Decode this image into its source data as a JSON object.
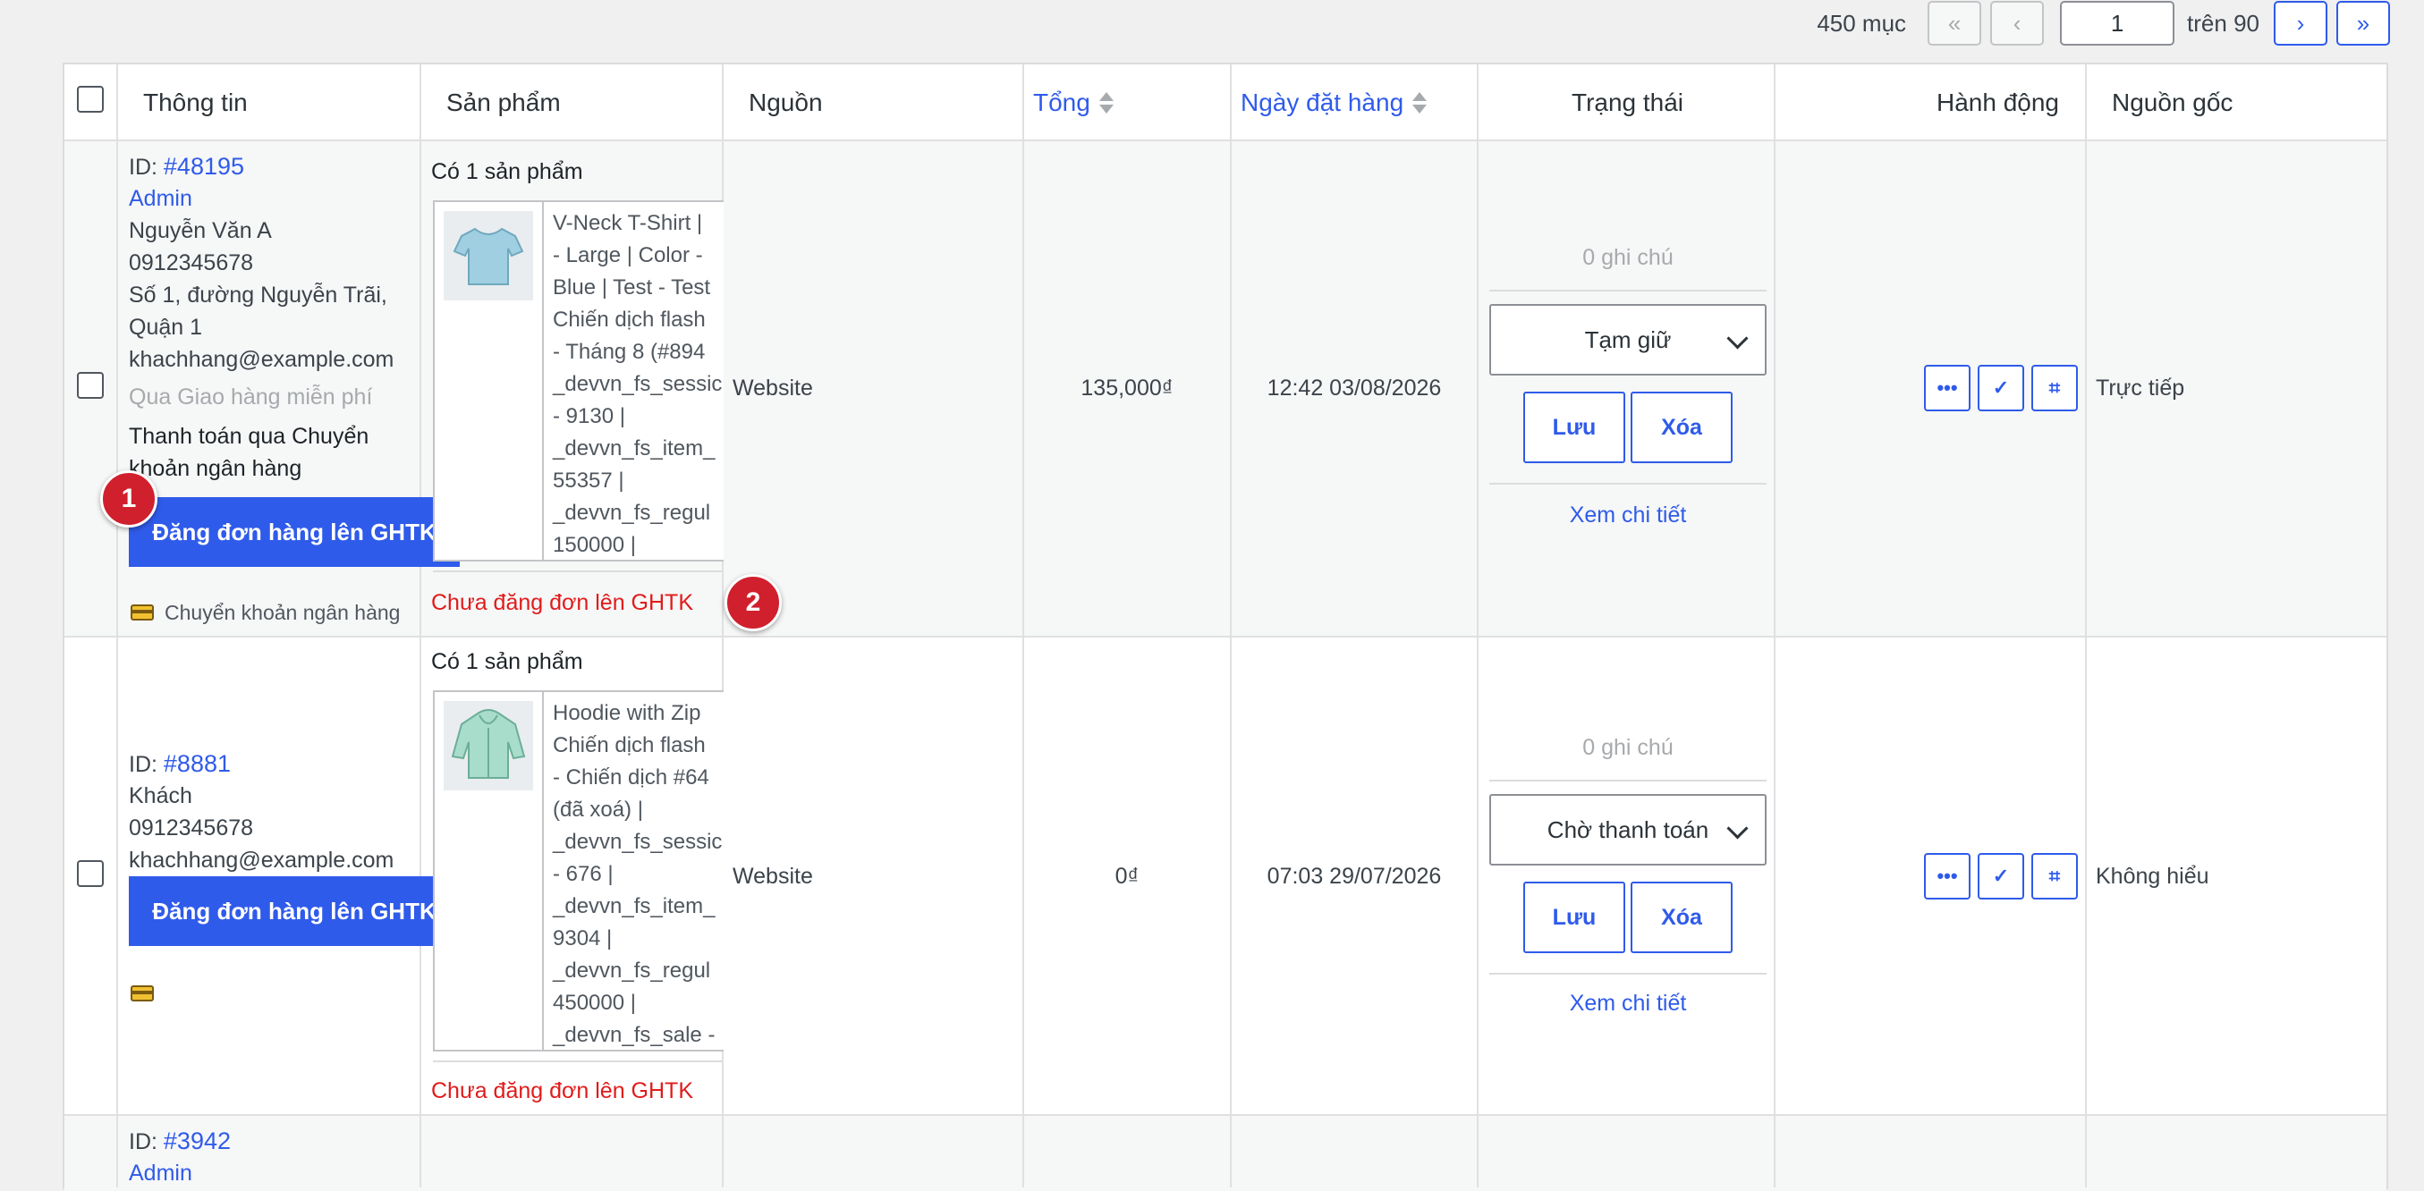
{
  "pagination": {
    "count_text": "450 mục",
    "first": "«",
    "prev": "‹",
    "current_page": "1",
    "total_text": "trên 90",
    "next": "›",
    "last": "»"
  },
  "columns": [
    "Thông tin",
    "Sản phẩm",
    "Nguồn",
    "Tổng",
    "Ngày đặt hàng",
    "Trạng thái",
    "Hành động",
    "Nguồn gốc"
  ],
  "orders": [
    {
      "id_prefix": "ID:",
      "id": "#48195",
      "creator": "Admin",
      "name": "Nguyễn Văn A",
      "phone": "0912345678",
      "address1": "Số 1, đường Nguyễn Trãi,",
      "address2": "Quận 1",
      "email": "khachhang@example.com",
      "shipping": "Qua Giao hàng miễn phí",
      "payment1": "Thanh toán qua Chuyển",
      "payment2": "khoản ngân hàng",
      "ghtk_button": "Đăng đơn hàng lên GHTK",
      "payment_badge": "Chuyển khoản ngân hàng",
      "product_count": "Có 1 sản phẩm",
      "product_lines": [
        "V-Neck T-Shirt |",
        "- Large | Color -",
        "Blue | Test - Test",
        "Chiến dịch flash",
        "- Tháng 8 (#894",
        "_devvn_fs_sessic",
        "- 9130 |",
        "_devvn_fs_item_",
        "55357 |",
        "_devvn_fs_regul",
        "150000 |"
      ],
      "ghtk_status": "Chưa đăng đơn lên GHTK",
      "source": "Website",
      "total": "135,000₫",
      "date": "12:42 03/08/2026",
      "notes": "0 ghi chú",
      "status": "Tạm giữ",
      "save": "Lưu",
      "delete": "Xóa",
      "view": "Xem chi tiết",
      "origin": "Trực tiếp"
    },
    {
      "id_prefix": "ID:",
      "id": "#8881",
      "creator": "Khách",
      "phone": "0912345678",
      "email": "khachhang@example.com",
      "ghtk_button": "Đăng đơn hàng lên GHTK",
      "product_count": "Có 1 sản phẩm",
      "product_lines": [
        "Hoodie with Zip",
        "Chiến dịch flash",
        "- Chiến dịch #64",
        "(đã xoá) |",
        "_devvn_fs_sessic",
        "- 676 |",
        "_devvn_fs_item_",
        "9304 |",
        "_devvn_fs_regul",
        "450000 |",
        "_devvn_fs_sale -"
      ],
      "ghtk_status": "Chưa đăng đơn lên GHTK",
      "source": "Website",
      "total": "0₫",
      "date": "07:03 29/07/2026",
      "notes": "0 ghi chú",
      "status": "Chờ thanh toán",
      "save": "Lưu",
      "delete": "Xóa",
      "view": "Xem chi tiết",
      "origin": "Không hiểu"
    },
    {
      "id_prefix": "ID:",
      "id": "#3942",
      "creator": "Admin"
    }
  ],
  "action_icons": [
    "more-icon",
    "check-icon",
    "crop-icon"
  ],
  "annotations": [
    "1",
    "2"
  ],
  "colors": {
    "accent": "#2f5bea",
    "danger": "#e11b1b",
    "badge": "#d0202d"
  }
}
